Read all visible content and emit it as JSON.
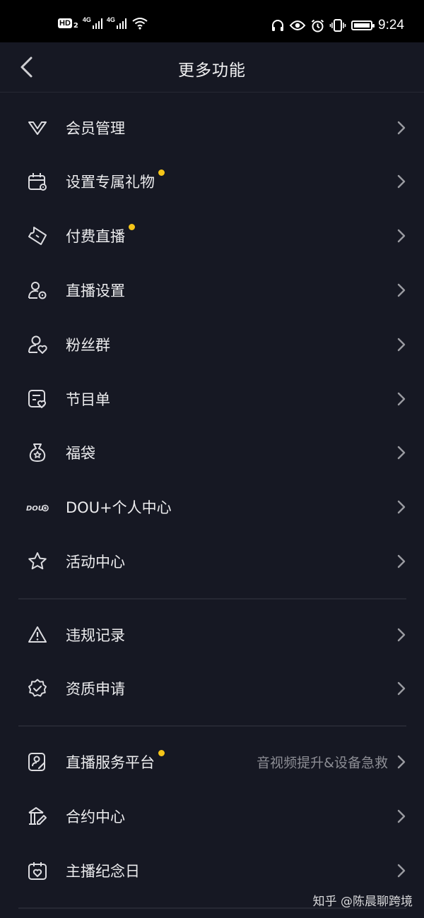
{
  "status_bar": {
    "hd_label": "HD",
    "hd_sub": "2",
    "net1": "4G",
    "net2": "4G",
    "time": "9:24"
  },
  "header": {
    "title": "更多功能"
  },
  "menu": {
    "group1": [
      {
        "label": "会员管理",
        "icon": "vip-v-icon",
        "dot": false
      },
      {
        "label": "设置专属礼物",
        "icon": "gift-calendar-icon",
        "dot": true
      },
      {
        "label": "付费直播",
        "icon": "ticket-icon",
        "dot": true
      },
      {
        "label": "直播设置",
        "icon": "user-settings-icon",
        "dot": false
      },
      {
        "label": "粉丝群",
        "icon": "user-heart-icon",
        "dot": false
      },
      {
        "label": "节目单",
        "icon": "program-list-icon",
        "dot": false
      },
      {
        "label": "福袋",
        "icon": "lucky-bag-icon",
        "dot": false
      },
      {
        "label": "DOU+个人中心",
        "icon": "dou-plus-icon",
        "dot": false
      },
      {
        "label": "活动中心",
        "icon": "star-icon",
        "dot": false
      }
    ],
    "group2": [
      {
        "label": "违规记录",
        "icon": "warning-icon",
        "dot": false
      },
      {
        "label": "资质申请",
        "icon": "verified-badge-icon",
        "dot": false
      }
    ],
    "group3": [
      {
        "label": "直播服务平台",
        "icon": "service-platform-icon",
        "dot": true,
        "sub": "音视频提升&设备急救"
      },
      {
        "label": "合约中心",
        "icon": "contract-building-icon",
        "dot": false
      },
      {
        "label": "主播纪念日",
        "icon": "anniversary-calendar-icon",
        "dot": false
      }
    ]
  },
  "watermark": "知乎 @陈晨聊跨境",
  "colors": {
    "background": "#161823",
    "dot": "#f5c518",
    "text": "#ececee",
    "subtext": "#8c8d94"
  }
}
